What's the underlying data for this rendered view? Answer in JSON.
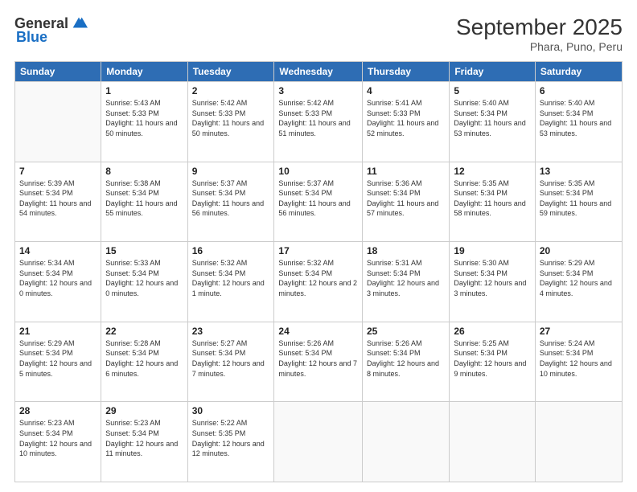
{
  "header": {
    "logo_general": "General",
    "logo_blue": "Blue",
    "month_title": "September 2025",
    "subtitle": "Phara, Puno, Peru"
  },
  "weekdays": [
    "Sunday",
    "Monday",
    "Tuesday",
    "Wednesday",
    "Thursday",
    "Friday",
    "Saturday"
  ],
  "weeks": [
    [
      {
        "day": "",
        "empty": true
      },
      {
        "day": "1",
        "sunrise": "5:43 AM",
        "sunset": "5:33 PM",
        "daylight": "11 hours and 50 minutes."
      },
      {
        "day": "2",
        "sunrise": "5:42 AM",
        "sunset": "5:33 PM",
        "daylight": "11 hours and 50 minutes."
      },
      {
        "day": "3",
        "sunrise": "5:42 AM",
        "sunset": "5:33 PM",
        "daylight": "11 hours and 51 minutes."
      },
      {
        "day": "4",
        "sunrise": "5:41 AM",
        "sunset": "5:33 PM",
        "daylight": "11 hours and 52 minutes."
      },
      {
        "day": "5",
        "sunrise": "5:40 AM",
        "sunset": "5:34 PM",
        "daylight": "11 hours and 53 minutes."
      },
      {
        "day": "6",
        "sunrise": "5:40 AM",
        "sunset": "5:34 PM",
        "daylight": "11 hours and 53 minutes."
      }
    ],
    [
      {
        "day": "7",
        "sunrise": "5:39 AM",
        "sunset": "5:34 PM",
        "daylight": "11 hours and 54 minutes."
      },
      {
        "day": "8",
        "sunrise": "5:38 AM",
        "sunset": "5:34 PM",
        "daylight": "11 hours and 55 minutes."
      },
      {
        "day": "9",
        "sunrise": "5:37 AM",
        "sunset": "5:34 PM",
        "daylight": "11 hours and 56 minutes."
      },
      {
        "day": "10",
        "sunrise": "5:37 AM",
        "sunset": "5:34 PM",
        "daylight": "11 hours and 56 minutes."
      },
      {
        "day": "11",
        "sunrise": "5:36 AM",
        "sunset": "5:34 PM",
        "daylight": "11 hours and 57 minutes."
      },
      {
        "day": "12",
        "sunrise": "5:35 AM",
        "sunset": "5:34 PM",
        "daylight": "11 hours and 58 minutes."
      },
      {
        "day": "13",
        "sunrise": "5:35 AM",
        "sunset": "5:34 PM",
        "daylight": "11 hours and 59 minutes."
      }
    ],
    [
      {
        "day": "14",
        "sunrise": "5:34 AM",
        "sunset": "5:34 PM",
        "daylight": "12 hours and 0 minutes."
      },
      {
        "day": "15",
        "sunrise": "5:33 AM",
        "sunset": "5:34 PM",
        "daylight": "12 hours and 0 minutes."
      },
      {
        "day": "16",
        "sunrise": "5:32 AM",
        "sunset": "5:34 PM",
        "daylight": "12 hours and 1 minute."
      },
      {
        "day": "17",
        "sunrise": "5:32 AM",
        "sunset": "5:34 PM",
        "daylight": "12 hours and 2 minutes."
      },
      {
        "day": "18",
        "sunrise": "5:31 AM",
        "sunset": "5:34 PM",
        "daylight": "12 hours and 3 minutes."
      },
      {
        "day": "19",
        "sunrise": "5:30 AM",
        "sunset": "5:34 PM",
        "daylight": "12 hours and 3 minutes."
      },
      {
        "day": "20",
        "sunrise": "5:29 AM",
        "sunset": "5:34 PM",
        "daylight": "12 hours and 4 minutes."
      }
    ],
    [
      {
        "day": "21",
        "sunrise": "5:29 AM",
        "sunset": "5:34 PM",
        "daylight": "12 hours and 5 minutes."
      },
      {
        "day": "22",
        "sunrise": "5:28 AM",
        "sunset": "5:34 PM",
        "daylight": "12 hours and 6 minutes."
      },
      {
        "day": "23",
        "sunrise": "5:27 AM",
        "sunset": "5:34 PM",
        "daylight": "12 hours and 7 minutes."
      },
      {
        "day": "24",
        "sunrise": "5:26 AM",
        "sunset": "5:34 PM",
        "daylight": "12 hours and 7 minutes."
      },
      {
        "day": "25",
        "sunrise": "5:26 AM",
        "sunset": "5:34 PM",
        "daylight": "12 hours and 8 minutes."
      },
      {
        "day": "26",
        "sunrise": "5:25 AM",
        "sunset": "5:34 PM",
        "daylight": "12 hours and 9 minutes."
      },
      {
        "day": "27",
        "sunrise": "5:24 AM",
        "sunset": "5:34 PM",
        "daylight": "12 hours and 10 minutes."
      }
    ],
    [
      {
        "day": "28",
        "sunrise": "5:23 AM",
        "sunset": "5:34 PM",
        "daylight": "12 hours and 10 minutes."
      },
      {
        "day": "29",
        "sunrise": "5:23 AM",
        "sunset": "5:34 PM",
        "daylight": "12 hours and 11 minutes."
      },
      {
        "day": "30",
        "sunrise": "5:22 AM",
        "sunset": "5:35 PM",
        "daylight": "12 hours and 12 minutes."
      },
      {
        "day": "",
        "empty": true
      },
      {
        "day": "",
        "empty": true
      },
      {
        "day": "",
        "empty": true
      },
      {
        "day": "",
        "empty": true
      }
    ]
  ]
}
